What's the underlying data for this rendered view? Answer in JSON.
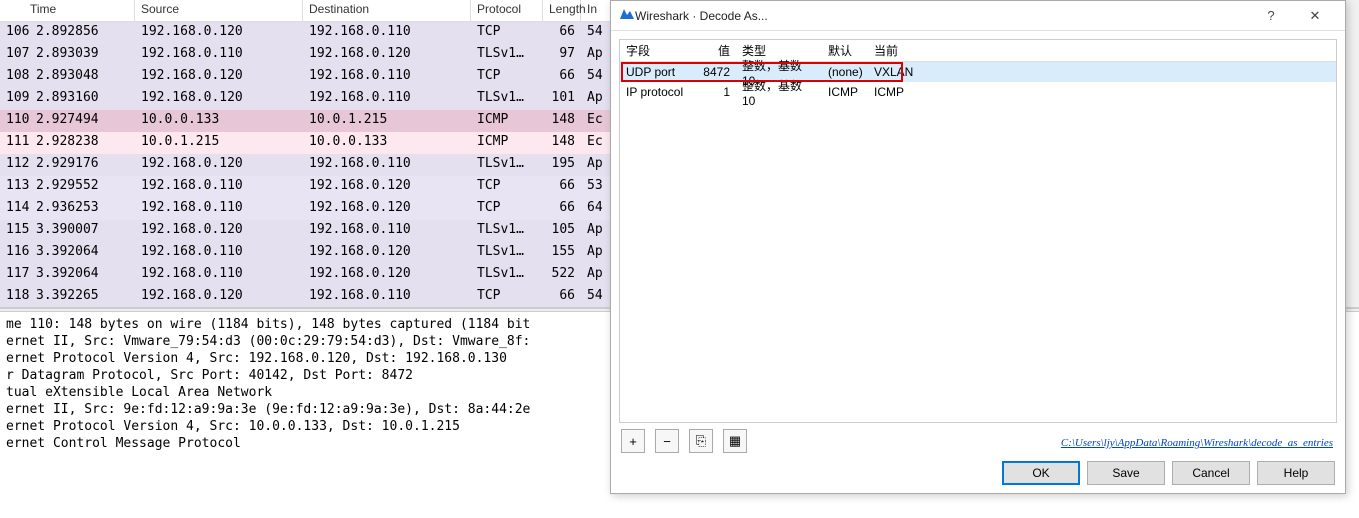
{
  "packet_headers": {
    "time": "Time",
    "source": "Source",
    "destination": "Destination",
    "protocol": "Protocol",
    "length": "Length",
    "info": "In"
  },
  "packets": [
    {
      "no": "106",
      "time": "2.892856",
      "src": "192.168.0.120",
      "dst": "192.168.0.110",
      "proto": "TCP",
      "len": "66",
      "info": "54",
      "cls": "row-lavender"
    },
    {
      "no": "107",
      "time": "2.893039",
      "src": "192.168.0.110",
      "dst": "192.168.0.120",
      "proto": "TLSv1…",
      "len": "97",
      "info": "Ap",
      "cls": "row-lavender"
    },
    {
      "no": "108",
      "time": "2.893048",
      "src": "192.168.0.120",
      "dst": "192.168.0.110",
      "proto": "TCP",
      "len": "66",
      "info": "54",
      "cls": "row-lavender"
    },
    {
      "no": "109",
      "time": "2.893160",
      "src": "192.168.0.120",
      "dst": "192.168.0.110",
      "proto": "TLSv1…",
      "len": "101",
      "info": "Ap",
      "cls": "row-lavender"
    },
    {
      "no": "110",
      "time": "2.927494",
      "src": "10.0.0.133",
      "dst": "10.0.1.215",
      "proto": "ICMP",
      "len": "148",
      "info": "Ec",
      "cls": "row-pink-dark"
    },
    {
      "no": "111",
      "time": "2.928238",
      "src": "10.0.1.215",
      "dst": "10.0.0.133",
      "proto": "ICMP",
      "len": "148",
      "info": "Ec",
      "cls": "row-pink-light"
    },
    {
      "no": "112",
      "time": "2.929176",
      "src": "192.168.0.120",
      "dst": "192.168.0.110",
      "proto": "TLSv1…",
      "len": "195",
      "info": "Ap",
      "cls": "row-lavender"
    },
    {
      "no": "113",
      "time": "2.929552",
      "src": "192.168.0.110",
      "dst": "192.168.0.120",
      "proto": "TCP",
      "len": "66",
      "info": "53",
      "cls": "row-lavender-light"
    },
    {
      "no": "114",
      "time": "2.936253",
      "src": "192.168.0.110",
      "dst": "192.168.0.120",
      "proto": "TCP",
      "len": "66",
      "info": "64",
      "cls": "row-lavender-light"
    },
    {
      "no": "115",
      "time": "3.390007",
      "src": "192.168.0.120",
      "dst": "192.168.0.110",
      "proto": "TLSv1…",
      "len": "105",
      "info": "Ap",
      "cls": "row-lavender"
    },
    {
      "no": "116",
      "time": "3.392064",
      "src": "192.168.0.110",
      "dst": "192.168.0.120",
      "proto": "TLSv1…",
      "len": "155",
      "info": "Ap",
      "cls": "row-lavender"
    },
    {
      "no": "117",
      "time": "3.392064",
      "src": "192.168.0.110",
      "dst": "192.168.0.120",
      "proto": "TLSv1…",
      "len": "522",
      "info": "Ap",
      "cls": "row-lavender"
    },
    {
      "no": "118",
      "time": "3.392265",
      "src": "192.168.0.120",
      "dst": "192.168.0.110",
      "proto": "TCP",
      "len": "66",
      "info": "54",
      "cls": "row-lavender"
    }
  ],
  "details": [
    "me 110: 148 bytes on wire (1184 bits), 148 bytes captured (1184 bit",
    "ernet II, Src: Vmware_79:54:d3 (00:0c:29:79:54:d3), Dst: Vmware_8f:",
    "ernet Protocol Version 4, Src: 192.168.0.120, Dst: 192.168.0.130",
    "r Datagram Protocol, Src Port: 40142, Dst Port: 8472",
    "tual eXtensible Local Area Network",
    "ernet II, Src: 9e:fd:12:a9:9a:3e (9e:fd:12:a9:9a:3e), Dst: 8a:44:2e",
    "ernet Protocol Version 4, Src: 10.0.0.133, Dst: 10.0.1.215",
    "ernet Control Message Protocol"
  ],
  "dialog": {
    "title": "Wireshark · Decode As...",
    "headers": {
      "field": "字段",
      "value": "值",
      "type": "类型",
      "default": "默认",
      "current": "当前"
    },
    "rows": [
      {
        "field": "UDP port",
        "value": "8472",
        "type": "整数，基数 10",
        "default": "(none)",
        "current": "VXLAN",
        "sel": true
      },
      {
        "field": "IP protocol",
        "value": "1",
        "type": "整数，基数 10",
        "default": "ICMP",
        "current": "ICMP",
        "sel": false
      }
    ],
    "path": "C:\\Users\\ljy\\AppData\\Roaming\\Wireshark\\decode_as_entries",
    "buttons": {
      "ok": "OK",
      "save": "Save",
      "cancel": "Cancel",
      "help": "Help"
    },
    "help_q": "?",
    "close_x": "✕",
    "plus": "+",
    "minus": "−",
    "copy": "⎘",
    "clear": "▦"
  }
}
